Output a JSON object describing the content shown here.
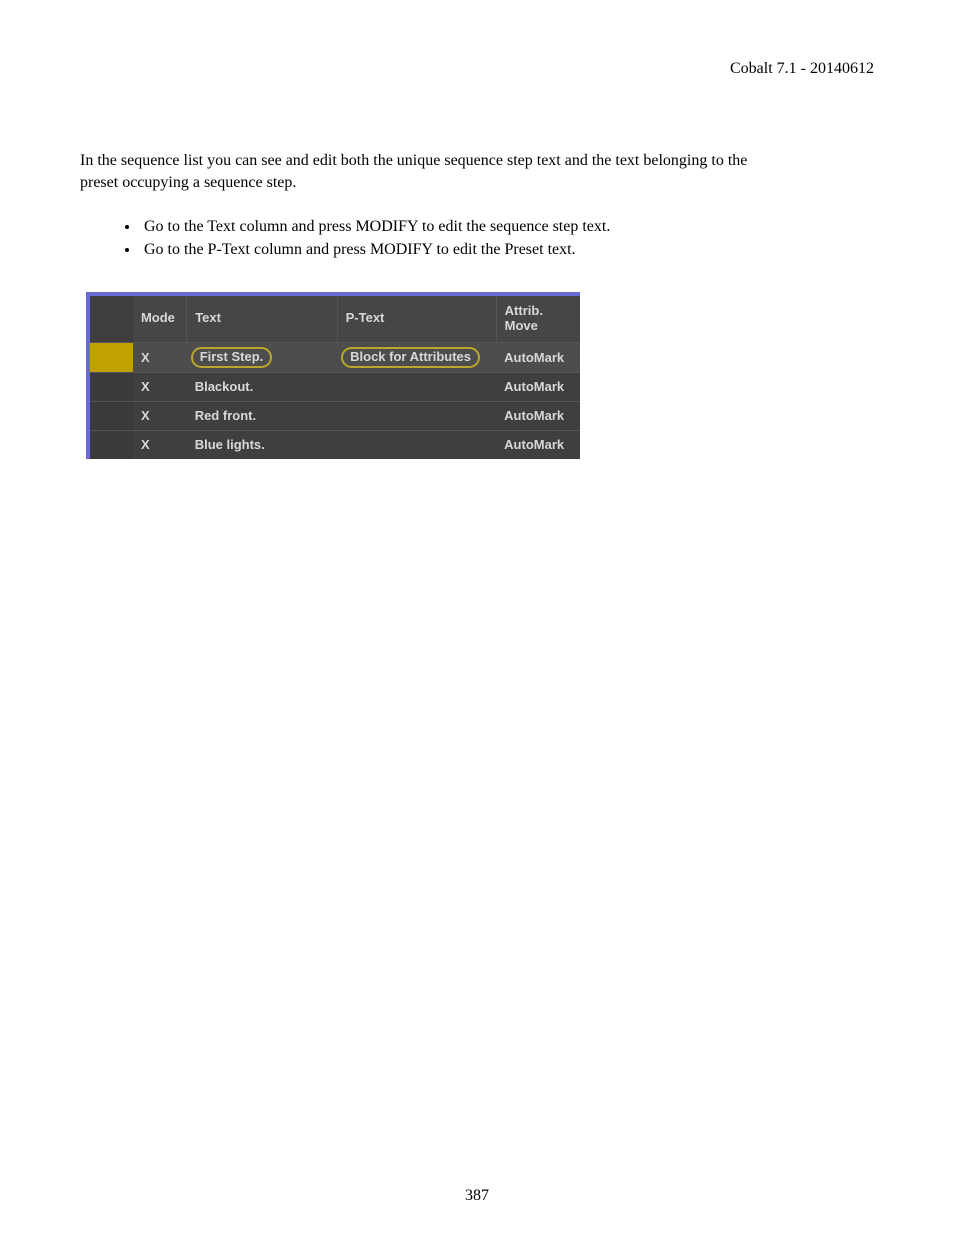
{
  "header": {
    "title": "Cobalt 7.1 - 20140612"
  },
  "paragraph": "In the sequence list you can see and edit both the unique sequence step text and the text belonging to the preset occupying a sequence step.",
  "bullets": [
    "Go to the Text column and press MODIFY to edit the sequence step text.",
    "Go to the P-Text column and press MODIFY to edit the Preset text."
  ],
  "table": {
    "headers": {
      "mode": "Mode",
      "text": "Text",
      "ptext": "P-Text",
      "attrib_line1": "Attrib.",
      "attrib_line2": "Move"
    },
    "rows": [
      {
        "mode": "X",
        "text": "First Step.",
        "ptext": "Block for Attributes",
        "attrib": "AutoMark",
        "selected": true,
        "text_hl": true,
        "ptext_hl": true
      },
      {
        "mode": "X",
        "text": "Blackout.",
        "ptext": "",
        "attrib": "AutoMark",
        "selected": false,
        "text_hl": false,
        "ptext_hl": false
      },
      {
        "mode": "X",
        "text": "Red front.",
        "ptext": "",
        "attrib": "AutoMark",
        "selected": false,
        "text_hl": false,
        "ptext_hl": false
      },
      {
        "mode": "X",
        "text": "Blue lights.",
        "ptext": "",
        "attrib": "AutoMark",
        "selected": false,
        "text_hl": false,
        "ptext_hl": false
      }
    ]
  },
  "footer": {
    "page_number": "387"
  }
}
